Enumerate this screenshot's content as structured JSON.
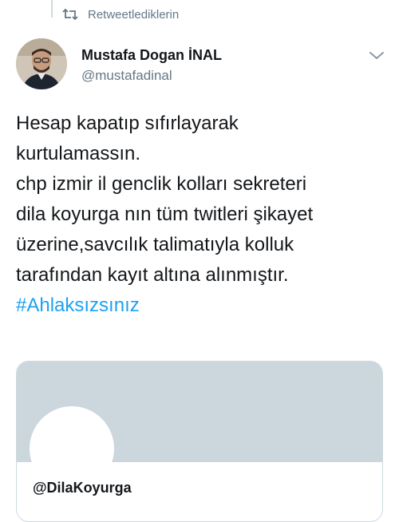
{
  "retweet": {
    "icon": "retweet-icon",
    "label": "Retweetlediklerin"
  },
  "author": {
    "avatar": "avatar",
    "display_name": "Mustafa Dogan İNAL",
    "handle": "@mustafadinal"
  },
  "menu": {
    "icon": "chevron-down-icon"
  },
  "tweet": {
    "lines": [
      "Hesap kapatıp sıfırlayarak",
      "kurtulamassın.",
      "chp izmir il genclik kolları sekreteri",
      "dila koyurga nın tüm twitleri şikayet",
      "üzerine,savcılık talimatıyla kolluk",
      "tarafından kayıt altına alınmıştır."
    ],
    "hashtag": "#Ahlaksızsınız"
  },
  "card": {
    "handle": "@DilaKoyurga"
  },
  "colors": {
    "link": "#1da1f2",
    "secondary_text": "#657786",
    "banner": "#ccd6dd"
  }
}
